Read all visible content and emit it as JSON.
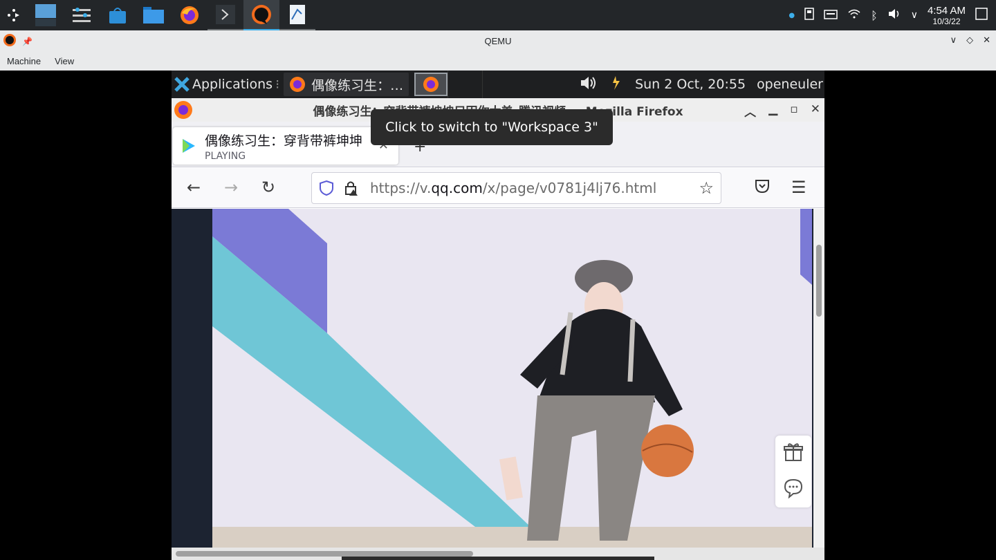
{
  "host": {
    "clock_time": "4:54 AM",
    "clock_date": "10/3/22"
  },
  "qemu": {
    "title": "QEMU",
    "menu": [
      "Machine",
      "View"
    ]
  },
  "guest_panel": {
    "applications": "Applications",
    "task_title": "偶像练习生：…",
    "datetime": "Sun  2 Oct, 20:55",
    "user": "openeuler"
  },
  "firefox": {
    "window_title": "偶像练习生：穿背带裤坤坤只因你太美_腾讯视频 — Mozilla Firefox",
    "tab_title": "偶像练习生：穿背带裤坤坤",
    "tab_status": "PLAYING",
    "tooltip": "Click to switch to \"Workspace 3\"",
    "url_prefix": "https://v.",
    "url_host": "qq.com",
    "url_path": "/x/page/v0781j4lj76.html"
  },
  "colors": {
    "accent": "#3daee9",
    "video_bg": "#e9e6f1",
    "stripe_blue": "#7b7ad6",
    "stripe_cyan": "#6fc6d6",
    "ball": "#d9773f"
  }
}
